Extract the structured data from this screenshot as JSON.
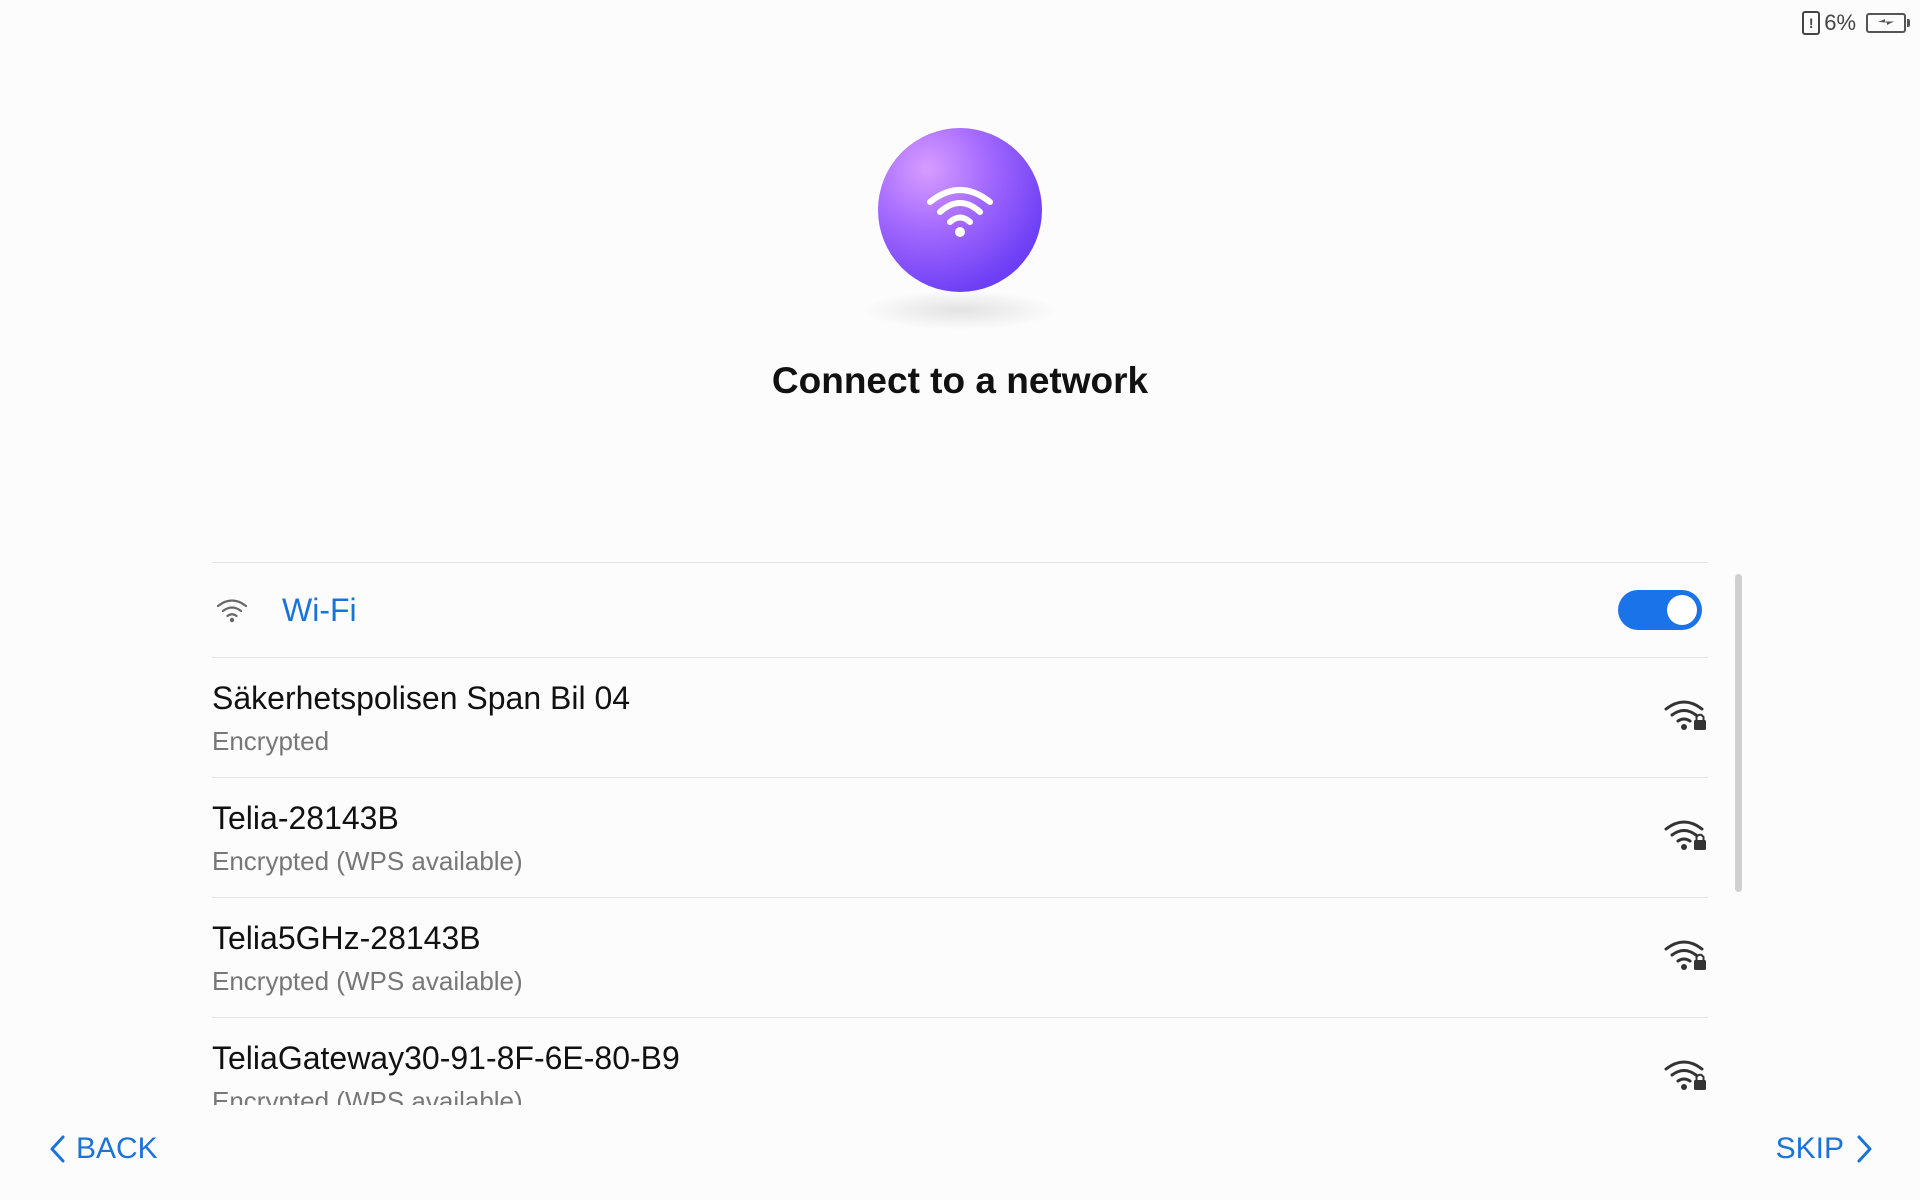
{
  "status_bar": {
    "alert_symbol": "!",
    "battery_percent": "6%",
    "battery_icon": "battery-charging-icon"
  },
  "hero": {
    "icon": "wifi-icon",
    "title": "Connect to a network"
  },
  "wifi": {
    "label": "Wi-Fi",
    "enabled": true
  },
  "networks": [
    {
      "name": "Säkerhetspolisen Span Bil 04",
      "status": "Encrypted"
    },
    {
      "name": "Telia-28143B",
      "status": "Encrypted (WPS available)"
    },
    {
      "name": "Telia5GHz-28143B",
      "status": "Encrypted (WPS available)"
    },
    {
      "name": "TeliaGateway30-91-8F-6E-80-B9",
      "status": "Encrypted (WPS available)"
    }
  ],
  "footer": {
    "back_label": "BACK",
    "skip_label": "SKIP"
  },
  "colors": {
    "accent": "#1a73d9",
    "hero_gradient_light": "#d89cff",
    "hero_gradient_dark": "#5a34ea"
  }
}
